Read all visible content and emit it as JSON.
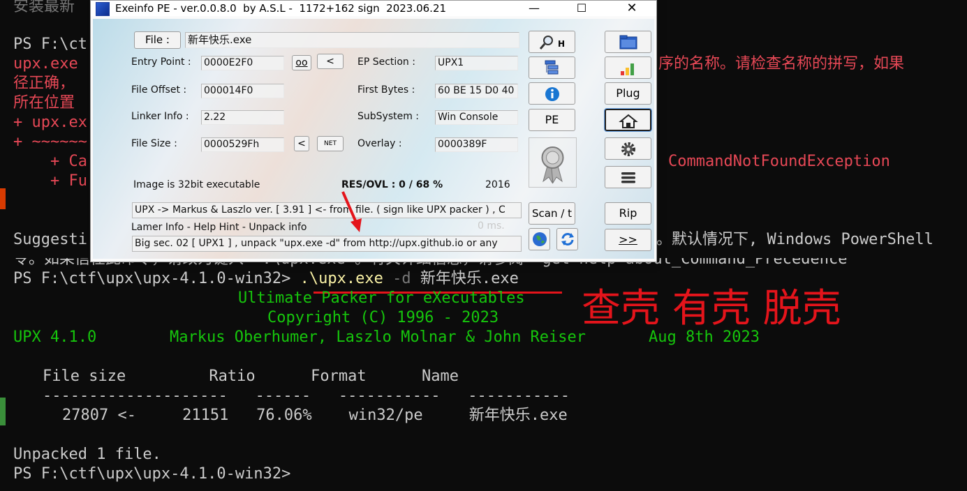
{
  "terminal": {
    "lines": [
      {
        "text": "安装最新",
        "color": "gray"
      },
      {
        "text": "PS F:\\ct",
        "color": "gray"
      },
      {
        "text": "upx.exe",
        "color": "red"
      },
      {
        "text": "径正确，",
        "color": "red"
      },
      {
        "text": "所在位置",
        "color": "red"
      },
      {
        "text": "+ upx.ex",
        "color": "red"
      },
      {
        "text": "+ ~~~~~~",
        "color": "red"
      },
      {
        "text": "    + Ca",
        "color": "red"
      },
      {
        "text": "    + Fu",
        "color": "red"
      }
    ],
    "right_error_1": "序的名称。请检查名称的拼写，如果",
    "right_error_2": "CommandNotFoundException",
    "suggest_start": "Suggesti",
    "suggest_right": "。默认情况下, Windows PowerShell",
    "line_ling": "令。如果信任此命令，请改为键入 \".\\upx.exe\"。有关详细信息，请参阅 \"get-help about_Command_Precedence",
    "prompt": "PS F:\\ctf\\upx\\upx-4.1.0-win32>",
    "command_exe": ".\\upx.exe",
    "command_flag": "-d",
    "command_arg": "新年快乐.exe",
    "upx_banner_1": "Ultimate Packer for eXecutables",
    "upx_banner_2": "Copyright (C) 1996 - 2023",
    "upx_version": "UPX 4.1.0",
    "upx_authors": "Markus Oberhumer, Laszlo Molnar & John Reiser",
    "upx_date": "Aug 8th 2023",
    "table_header": "File size         Ratio      Format      Name",
    "table_rule": "--------------------   ------   -----------   -----------",
    "table_row": "27807 <-     21151   76.06%    win32/pe     新年快乐.exe",
    "unpacked": "Unpacked 1 file.",
    "prompt_end": "PS F:\\ctf\\upx\\upx-4.1.0-win32>",
    "annotation": "查壳 有壳 脱壳"
  },
  "exeinfo": {
    "title": "Exeinfo PE - ver.0.0.8.0  by A.S.L -  1172+162 sign  2023.06.21",
    "window_controls": {
      "minimize": "—",
      "maximize": "☐",
      "close": "✕"
    },
    "file_button": "File :",
    "file_name": "新年快乐.exe",
    "entry_point_label": "Entry Point :",
    "entry_point": "0000E2F0",
    "oo_button": "oo",
    "lt_button": "<",
    "ep_section_label": "EP Section :",
    "ep_section": "UPX1",
    "file_offset_label": "File Offset :",
    "file_offset": "000014F0",
    "first_bytes_label": "First Bytes :",
    "first_bytes": "60 BE 15 D0 40",
    "linker_label": "Linker Info :",
    "linker": "2.22",
    "subsystem_label": "SubSystem :",
    "subsystem": "Win Console",
    "file_size_label": "File Size :",
    "file_size": "0000529Fh",
    "lt_button2": "<",
    "net_button": "NET",
    "overlay_label": "Overlay :",
    "overlay": "0000389F",
    "image_info": "Image is 32bit executable",
    "res_ovl": "RES/OVL : 0 / 68 %",
    "year": "2016",
    "detect_text": "UPX -> Markus & Laszlo ver. [ 3.91 ] <- from file. ( sign like UPX packer ) , C",
    "lamer_info": "Lamer Info - Help Hint - Unpack info",
    "ms": "0 ms.",
    "hint_text": "Big sec. 02 [ UPX1 ] , unpack \"upx.exe -d\"  from  http://upx.github.io or any",
    "search_button": "H",
    "pe_button": "PE",
    "scan_button": "Scan / t",
    "plug_button": "Plug",
    "rip_button": "Rip",
    "next_button": ">>",
    "colors": {
      "terminal_bg": "#0c0c0c",
      "error_red": "#e74856",
      "upx_green": "#16c60c",
      "annotation_red": "#e4141b"
    }
  }
}
